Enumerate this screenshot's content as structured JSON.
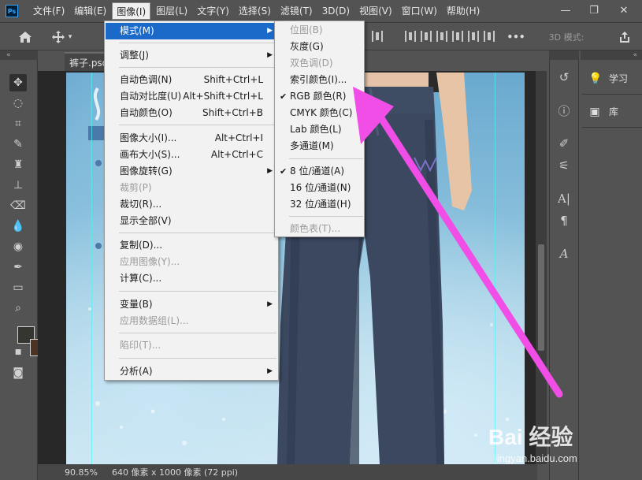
{
  "app": {
    "logo_text": "Ps"
  },
  "menubar": {
    "items": [
      "文件(F)",
      "编辑(E)",
      "图像(I)",
      "图层(L)",
      "文字(Y)",
      "选择(S)",
      "滤镜(T)",
      "3D(D)",
      "视图(V)",
      "窗口(W)",
      "帮助(H)"
    ],
    "active": "图像(I)",
    "window_controls": {
      "minimize": "—",
      "restore": "❐",
      "close": "✕"
    }
  },
  "options_bar": {
    "mode_3d_label": "3D 模式:",
    "more_label": "•••"
  },
  "document": {
    "tab_title": "裤子.psd",
    "zoom": "90.85%",
    "size_info": "640 像素 x 1000 像素 (72 ppi)"
  },
  "image_menu": {
    "items": [
      {
        "label": "模式(M)",
        "submenu": true,
        "highlighted": true
      },
      {
        "label": "调整(J)",
        "submenu": true
      },
      {
        "label": "自动色调(N)",
        "shortcut": "Shift+Ctrl+L"
      },
      {
        "label": "自动对比度(U)",
        "shortcut": "Alt+Shift+Ctrl+L"
      },
      {
        "label": "自动颜色(O)",
        "shortcut": "Shift+Ctrl+B"
      },
      {
        "label": "图像大小(I)...",
        "shortcut": "Alt+Ctrl+I"
      },
      {
        "label": "画布大小(S)...",
        "shortcut": "Alt+Ctrl+C"
      },
      {
        "label": "图像旋转(G)",
        "submenu": true
      },
      {
        "label": "裁剪(P)",
        "disabled": true
      },
      {
        "label": "裁切(R)..."
      },
      {
        "label": "显示全部(V)"
      },
      {
        "label": "复制(D)..."
      },
      {
        "label": "应用图像(Y)...",
        "disabled": true
      },
      {
        "label": "计算(C)..."
      },
      {
        "label": "变量(B)",
        "submenu": true
      },
      {
        "label": "应用数据组(L)...",
        "disabled": true
      },
      {
        "label": "陷印(T)...",
        "disabled": true
      },
      {
        "label": "分析(A)",
        "submenu": true
      }
    ]
  },
  "mode_submenu": {
    "items": [
      {
        "label": "位图(B)",
        "disabled": true
      },
      {
        "label": "灰度(G)"
      },
      {
        "label": "双色调(D)",
        "disabled": true
      },
      {
        "label": "索引颜色(I)..."
      },
      {
        "label": "RGB 颜色(R)",
        "checked": true
      },
      {
        "label": "CMYK 颜色(C)"
      },
      {
        "label": "Lab 颜色(L)"
      },
      {
        "label": "多通道(M)"
      },
      {
        "label": "8 位/通道(A)",
        "checked": true
      },
      {
        "label": "16 位/通道(N)"
      },
      {
        "label": "32 位/通道(H)"
      },
      {
        "label": "颜色表(T)...",
        "disabled": true
      }
    ]
  },
  "right_panels": {
    "learn_label": "学习",
    "library_label": "库"
  },
  "colors": {
    "foreground": "#34362f",
    "background": "#4b3424",
    "menu_highlight": "#1b6ac9",
    "annotation_arrow": "#f04ee6"
  },
  "watermark": {
    "brand": "Bai  经验",
    "url": "jingyan.baidu.com"
  }
}
